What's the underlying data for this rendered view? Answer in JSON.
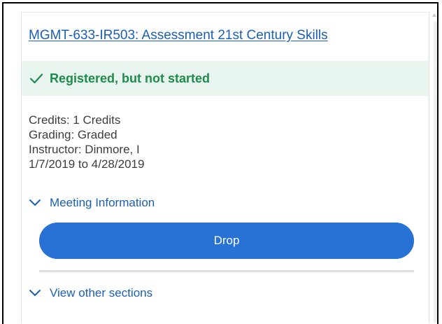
{
  "course": {
    "title": "MGMT-633-IR503: Assessment 21st Century Skills"
  },
  "status": {
    "icon": "check-icon",
    "text": "Registered, but not started",
    "color": "#1f8a4c",
    "background": "#e8f5ee"
  },
  "details": {
    "credits": "Credits: 1 Credits",
    "grading": "Grading: Graded",
    "instructor": "Instructor: Dinmore, I",
    "dates": "1/7/2019 to 4/28/2019"
  },
  "meeting_toggle": {
    "icon": "chevron-down-icon",
    "label": "Meeting Information"
  },
  "drop_button": {
    "label": "Drop",
    "color": "#2872d6"
  },
  "sections_toggle": {
    "icon": "chevron-down-icon",
    "label": "View other sections"
  },
  "accent_color": "#1a5fb4"
}
